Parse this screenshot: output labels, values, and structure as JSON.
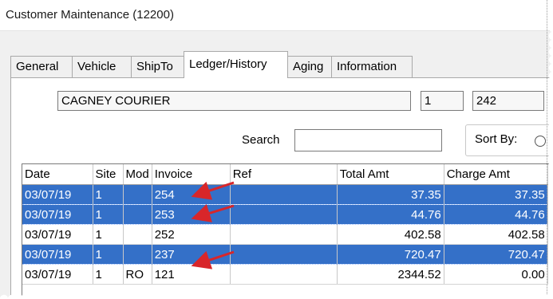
{
  "window": {
    "title": "Customer Maintenance (12200)"
  },
  "tabs": [
    {
      "label": "General",
      "active": false
    },
    {
      "label": "Vehicle",
      "active": false
    },
    {
      "label": "ShipTo",
      "active": false
    },
    {
      "label": "Ledger/History",
      "active": true
    },
    {
      "label": "Aging",
      "active": false
    },
    {
      "label": "Information",
      "active": false
    }
  ],
  "customer": {
    "name": "CAGNEY COURIER",
    "field_a": "1",
    "field_b": "242"
  },
  "search": {
    "label": "Search",
    "value": ""
  },
  "sort": {
    "label": "Sort By:"
  },
  "grid": {
    "columns": [
      "Date",
      "Site",
      "Mod",
      "Invoice",
      "Ref",
      "Total Amt",
      "Charge Amt"
    ],
    "rows": [
      {
        "date": "03/07/19",
        "site": "1",
        "mod": "",
        "invoice": "254",
        "ref": "",
        "total": "37.35",
        "charge": "37.35",
        "selected": true
      },
      {
        "date": "03/07/19",
        "site": "1",
        "mod": "",
        "invoice": "253",
        "ref": "",
        "total": "44.76",
        "charge": "44.76",
        "selected": true
      },
      {
        "date": "03/07/19",
        "site": "1",
        "mod": "",
        "invoice": "252",
        "ref": "",
        "total": "402.58",
        "charge": "402.58",
        "selected": false
      },
      {
        "date": "03/07/19",
        "site": "1",
        "mod": "",
        "invoice": "237",
        "ref": "",
        "total": "720.47",
        "charge": "720.47",
        "selected": true
      },
      {
        "date": "03/07/19",
        "site": "1",
        "mod": "RO",
        "invoice": "121",
        "ref": "",
        "total": "2344.52",
        "charge": "0.00",
        "selected": false
      }
    ]
  },
  "colors": {
    "selection": "#3470c8",
    "arrow": "#d8262a"
  }
}
